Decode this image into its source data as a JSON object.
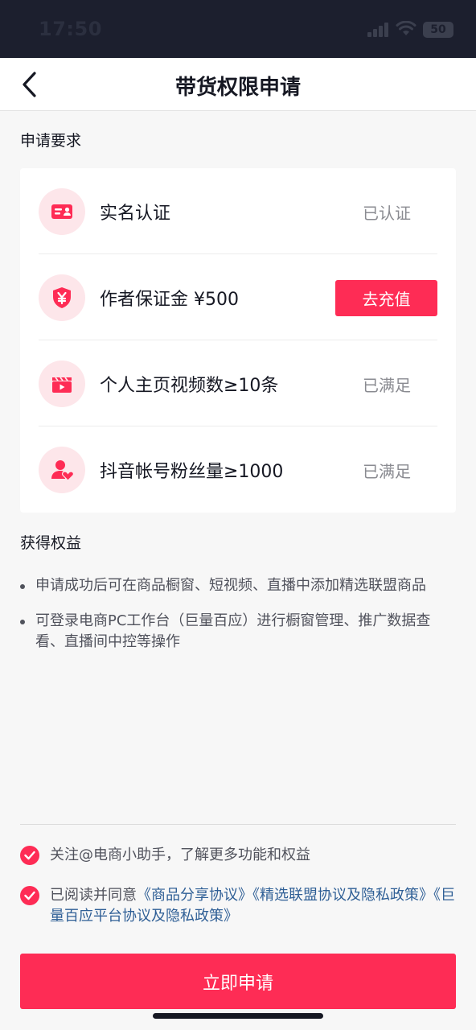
{
  "status_bar": {
    "time": "17:50",
    "battery": "50"
  },
  "header": {
    "title": "带货权限申请",
    "back_icon": "chevron-left-icon"
  },
  "requirements": {
    "title": "申请要求",
    "items": [
      {
        "icon": "id-card-icon",
        "label": "实名认证",
        "status": "已认证"
      },
      {
        "icon": "yuan-shield-icon",
        "label": "作者保证金 ¥500",
        "action": "去充值"
      },
      {
        "icon": "video-clapper-icon",
        "label": "个人主页视频数≥10条",
        "status": "已满足"
      },
      {
        "icon": "user-heart-icon",
        "label": "抖音帐号粉丝量≥1000",
        "status": "已满足"
      }
    ]
  },
  "benefits": {
    "title": "获得权益",
    "items": [
      "申请成功后可在商品橱窗、短视频、直播中添加精选联盟商品",
      "可登录电商PC工作台（巨量百应）进行橱窗管理、推广数据查看、直播间中控等操作"
    ]
  },
  "agreements": {
    "follow_text": "关注@电商小助手，了解更多功能和权益",
    "read_prefix": "已阅读并同意",
    "link1": "《商品分享协议》",
    "link2": "《精选联盟协议及隐私政策》",
    "link3": "《巨量百应平台协议及隐私政策》"
  },
  "submit_label": "立即申请",
  "colors": {
    "accent": "#fe2c55",
    "link": "#2f5f96",
    "icon_bg": "#fde6ea"
  }
}
